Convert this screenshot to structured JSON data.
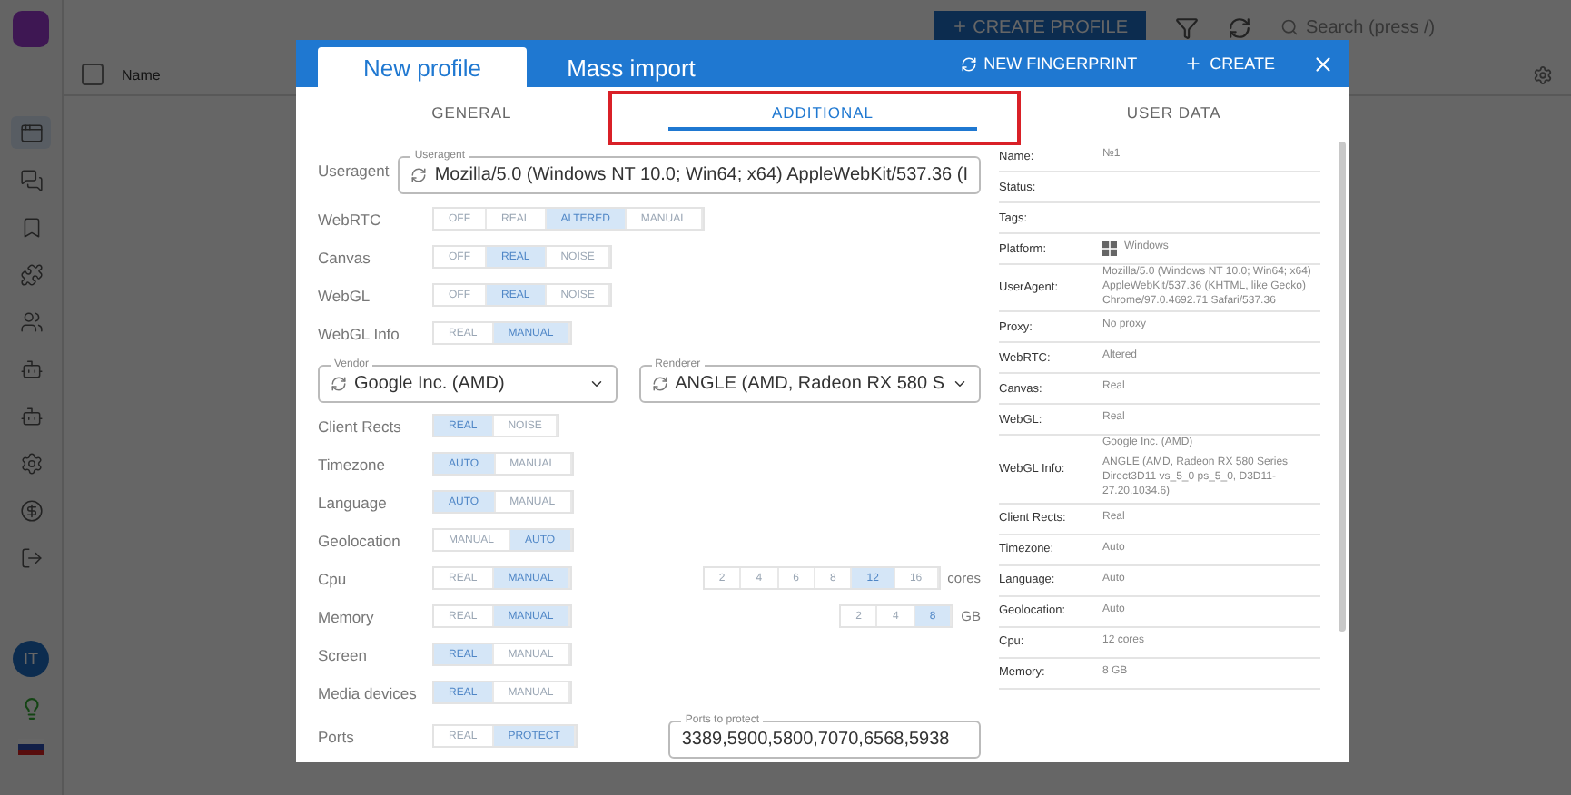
{
  "app": {
    "create_button": "CREATE PROFILE",
    "search": {
      "placeholder": "Search (press /)"
    },
    "table": {
      "columns": [
        "Name"
      ],
      "select_all_checked": false
    },
    "avatar": "IT"
  },
  "dialog": {
    "tabs": [
      {
        "label": "New profile",
        "selected": true
      },
      {
        "label": "Mass import",
        "selected": false
      }
    ],
    "actions": [
      "NEW FINGERPRINT",
      "CREATE"
    ],
    "sections": [
      {
        "label": "GENERAL",
        "selected": false
      },
      {
        "label": "ADDITIONAL",
        "selected": true
      },
      {
        "label": "USER DATA",
        "selected": false
      }
    ],
    "form": [
      {
        "kind": "field",
        "label": "Useragent",
        "legend": "Useragent",
        "value": "Mozilla/5.0 (Windows NT 10.0; Win64; x64) AppleWebKit/537.36 (I"
      },
      {
        "kind": "toggle",
        "label": "WebRTC",
        "options": [
          {
            "label": "OFF",
            "selected": false
          },
          {
            "label": "REAL",
            "selected": false
          },
          {
            "label": "ALTERED",
            "selected": true
          },
          {
            "label": "MANUAL",
            "selected": false
          }
        ]
      },
      {
        "kind": "toggle",
        "label": "Canvas",
        "options": [
          {
            "label": "OFF",
            "selected": false
          },
          {
            "label": "REAL",
            "selected": true
          },
          {
            "label": "NOISE",
            "selected": false
          }
        ]
      },
      {
        "kind": "toggle",
        "label": "WebGL",
        "options": [
          {
            "label": "OFF",
            "selected": false
          },
          {
            "label": "REAL",
            "selected": true
          },
          {
            "label": "NOISE",
            "selected": false
          }
        ]
      },
      {
        "kind": "toggle",
        "label": "WebGL Info",
        "options": [
          {
            "label": "REAL",
            "selected": false
          },
          {
            "label": "MANUAL",
            "selected": true
          }
        ]
      },
      {
        "kind": "pair",
        "fields": [
          {
            "legend": "Vendor",
            "value": "Google Inc. (AMD)"
          },
          {
            "legend": "Renderer",
            "value": "ANGLE (AMD, Radeon RX 580 S"
          }
        ]
      },
      {
        "kind": "toggle",
        "label": "Client Rects",
        "options": [
          {
            "label": "REAL",
            "selected": true
          },
          {
            "label": "NOISE",
            "selected": false
          }
        ]
      },
      {
        "kind": "toggle",
        "label": "Timezone",
        "options": [
          {
            "label": "AUTO",
            "selected": true
          },
          {
            "label": "MANUAL",
            "selected": false
          }
        ]
      },
      {
        "kind": "toggle",
        "label": "Language",
        "options": [
          {
            "label": "AUTO",
            "selected": true
          },
          {
            "label": "MANUAL",
            "selected": false
          }
        ]
      },
      {
        "kind": "toggle",
        "label": "Geolocation",
        "options": [
          {
            "label": "MANUAL",
            "selected": false
          },
          {
            "label": "AUTO",
            "selected": true
          }
        ]
      },
      {
        "kind": "toggle",
        "label": "Cpu",
        "options": [
          {
            "label": "REAL",
            "selected": false
          },
          {
            "label": "MANUAL",
            "selected": true
          }
        ],
        "extra": {
          "options": [
            {
              "label": "2",
              "selected": false
            },
            {
              "label": "4",
              "selected": false
            },
            {
              "label": "6",
              "selected": false
            },
            {
              "label": "8",
              "selected": false
            },
            {
              "label": "12",
              "selected": true
            },
            {
              "label": "16",
              "selected": false
            }
          ],
          "unit": "cores"
        }
      },
      {
        "kind": "toggle",
        "label": "Memory",
        "options": [
          {
            "label": "REAL",
            "selected": false
          },
          {
            "label": "MANUAL",
            "selected": true
          }
        ],
        "extra": {
          "options": [
            {
              "label": "2",
              "selected": false
            },
            {
              "label": "4",
              "selected": false
            },
            {
              "label": "8",
              "selected": true
            }
          ],
          "unit": "GB"
        }
      },
      {
        "kind": "toggle",
        "label": "Screen",
        "options": [
          {
            "label": "REAL",
            "selected": true
          },
          {
            "label": "MANUAL",
            "selected": false
          }
        ]
      },
      {
        "kind": "toggle",
        "label": "Media devices",
        "options": [
          {
            "label": "REAL",
            "selected": true
          },
          {
            "label": "MANUAL",
            "selected": false
          }
        ]
      },
      {
        "kind": "toggle",
        "label": "Ports",
        "options": [
          {
            "label": "REAL",
            "selected": false
          },
          {
            "label": "PROTECT",
            "selected": true
          }
        ],
        "field": {
          "legend": "Ports to protect",
          "value": "3389,5900,5800,7070,6568,5938"
        }
      }
    ],
    "summary": [
      {
        "label": "Name:",
        "lines": [
          "№1"
        ]
      },
      {
        "label": "Status:"
      },
      {
        "label": "Tags:"
      },
      {
        "label": "Platform:",
        "lines": [
          "Windows"
        ],
        "kind": "platform"
      },
      {
        "label": "UserAgent:",
        "lines": [
          "Mozilla/5.0 (Windows NT 10.0; Win64; x64) AppleWebKit/537.36 (KHTML, like Gecko) Chrome/97.0.4692.71 Safari/537.36"
        ]
      },
      {
        "label": "Proxy:",
        "lines": [
          "No proxy"
        ]
      },
      {
        "label": "WebRTC:",
        "lines": [
          "Altered"
        ]
      },
      {
        "label": "Canvas:",
        "lines": [
          "Real"
        ]
      },
      {
        "label": "WebGL:",
        "lines": [
          "Real"
        ]
      },
      {
        "label": "WebGL Info:",
        "lines": [
          "Google Inc. (AMD)",
          "ANGLE (AMD, Radeon RX 580 Series Direct3D11 vs_5_0 ps_5_0, D3D11-27.20.1034.6)"
        ]
      },
      {
        "label": "Client Rects:",
        "lines": [
          "Real"
        ]
      },
      {
        "label": "Timezone:",
        "lines": [
          "Auto"
        ]
      },
      {
        "label": "Language:",
        "lines": [
          "Auto"
        ]
      },
      {
        "label": "Geolocation:",
        "lines": [
          "Auto"
        ]
      },
      {
        "label": "Cpu:",
        "lines": [
          "12 cores"
        ]
      },
      {
        "label": "Memory:",
        "lines": [
          "8 GB"
        ]
      }
    ]
  }
}
